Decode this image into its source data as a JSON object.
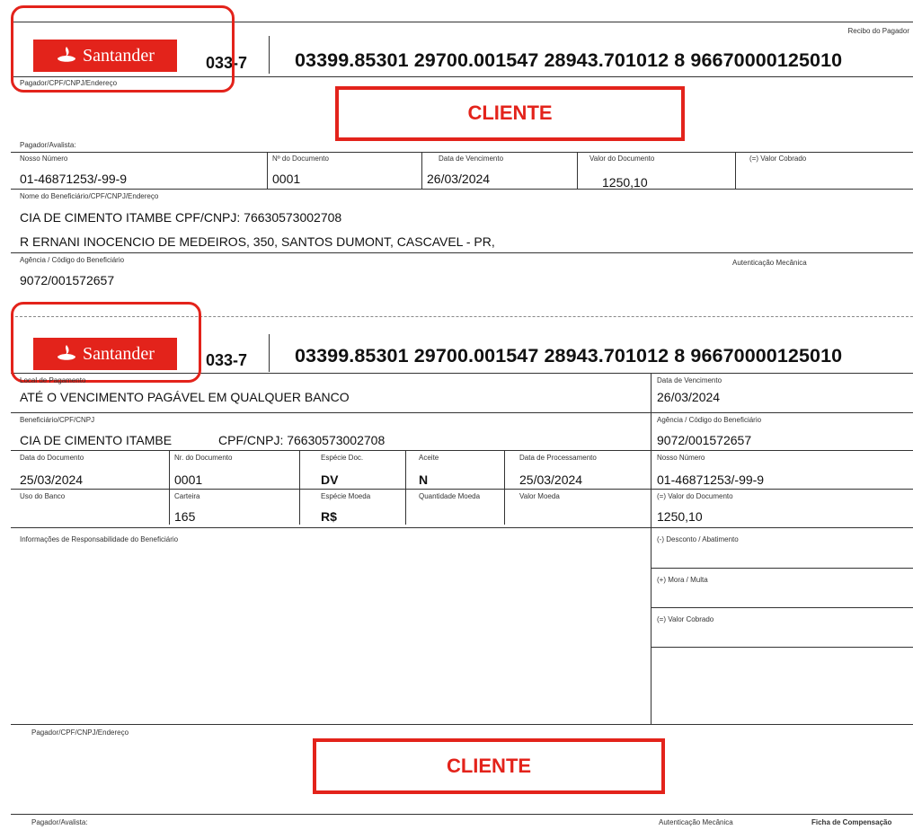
{
  "recibo": {
    "title": "Recibo do Pagador",
    "logo_text": "Santander",
    "bank_code": "033-7",
    "digitable_line": "03399.85301  29700.001547  28943.701012  8  96670000125010",
    "pagador_label": "Pagador/CPF/CNPJ/Endereço",
    "client_text": "CLIENTE",
    "avalista_label": "Pagador/Avalista:",
    "fields": {
      "nosso_numero_label": "Nosso Número",
      "nosso_numero": "01-46871253/-99-9",
      "n_documento_label": "Nº do Documento",
      "n_documento": "0001",
      "vencimento_label": "Data de Vencimento",
      "vencimento": "26/03/2024",
      "valor_documento_label": "Valor do Documento",
      "valor_documento": "1250,10",
      "valor_cobrado_label": "(=) Valor Cobrado"
    },
    "beneficiario_label": "Nome do Beneficiário/CPF/CNPJ/Endereço",
    "beneficiario_line1": "CIA DE CIMENTO ITAMBE  CPF/CNPJ: 76630573002708",
    "beneficiario_line2": "R ERNANI INOCENCIO DE MEDEIROS, 350, SANTOS DUMONT, CASCAVEL - PR,",
    "agencia_label": "Agência / Código do Beneficiário",
    "agencia": "9072/001572657",
    "autenticacao_label": "Autenticação Mecânica"
  },
  "ficha": {
    "logo_text": "Santander",
    "bank_code": "033-7",
    "digitable_line": "03399.85301  29700.001547  28943.701012  8  96670000125010",
    "local_pagamento_label": "Local de Pagamento",
    "local_pagamento": "ATÉ O VENCIMENTO PAGÁVEL EM QUALQUER BANCO",
    "beneficiario_label": "Beneficiário/CPF/CNPJ",
    "beneficiario_name": "CIA DE CIMENTO ITAMBE",
    "beneficiario_cnpj": "CPF/CNPJ: 76630573002708",
    "data_documento_label": "Data do Documento",
    "data_documento": "25/03/2024",
    "nr_documento_label": "Nr. do Documento",
    "nr_documento": "0001",
    "especie_doc_label": "Espécie Doc.",
    "especie_doc": "DV",
    "aceite_label": "Aceite",
    "aceite": "N",
    "data_processamento_label": "Data de Processamento",
    "data_processamento": "25/03/2024",
    "uso_banco_label": "Uso do Banco",
    "carteira_label": "Carteira",
    "carteira": "165",
    "especie_moeda_label": "Espécie Moeda",
    "especie_moeda": "R$",
    "quantidade_moeda_label": "Quantidade Moeda",
    "valor_moeda_label": "Valor Moeda",
    "vencimento_label": "Data de Vencimento",
    "vencimento": "26/03/2024",
    "agencia_label": "Agência / Código do Beneficiário",
    "agencia": "9072/001572657",
    "nosso_numero_label": "Nosso Número",
    "nosso_numero": "01-46871253/-99-9",
    "valor_documento_label": "(=) Valor do Documento",
    "valor_documento": "1250,10",
    "desconto_label": "(-) Desconto / Abatimento",
    "mora_label": "(+) Mora / Multa",
    "valor_cobrado_label": "(=) Valor Cobrado",
    "informacoes_label": "Informações de Responsabilidade do Beneficiário",
    "pagador_label": "Pagador/CPF/CNPJ/Endereço",
    "client_text": "CLIENTE",
    "avalista_label": "Pagador/Avalista:",
    "autenticacao_label": "Autenticação Mecânica",
    "ficha_label": "Ficha de Compensação"
  },
  "colors": {
    "santander_red": "#e3231b",
    "annotation_red": "#e3231b"
  }
}
